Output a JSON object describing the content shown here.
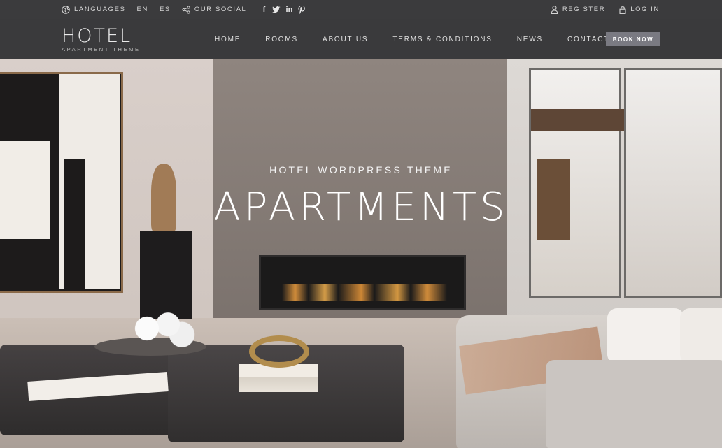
{
  "topbar": {
    "languages_label": "LANGUAGES",
    "lang_en": "EN",
    "lang_es": "ES",
    "social_label": "OUR SOCIAL",
    "social_icons": [
      "facebook-icon",
      "twitter-icon",
      "linkedin-icon",
      "pinterest-icon"
    ],
    "register_label": "REGISTER",
    "login_label": "LOG IN"
  },
  "header": {
    "logo_main": "HOTEL",
    "logo_sub": "APARTMENT THEME",
    "nav": [
      "HOME",
      "ROOMS",
      "ABOUT US",
      "TERMS & CONDITIONS",
      "NEWS",
      "CONTACT"
    ],
    "book_label": "BOOK NOW"
  },
  "hero": {
    "kicker": "HOTEL WORDPRESS THEME",
    "headline": "APARTMENTS"
  },
  "colors": {
    "bar_bg": "#3b3b3d",
    "book_bg": "#7a7a82"
  }
}
